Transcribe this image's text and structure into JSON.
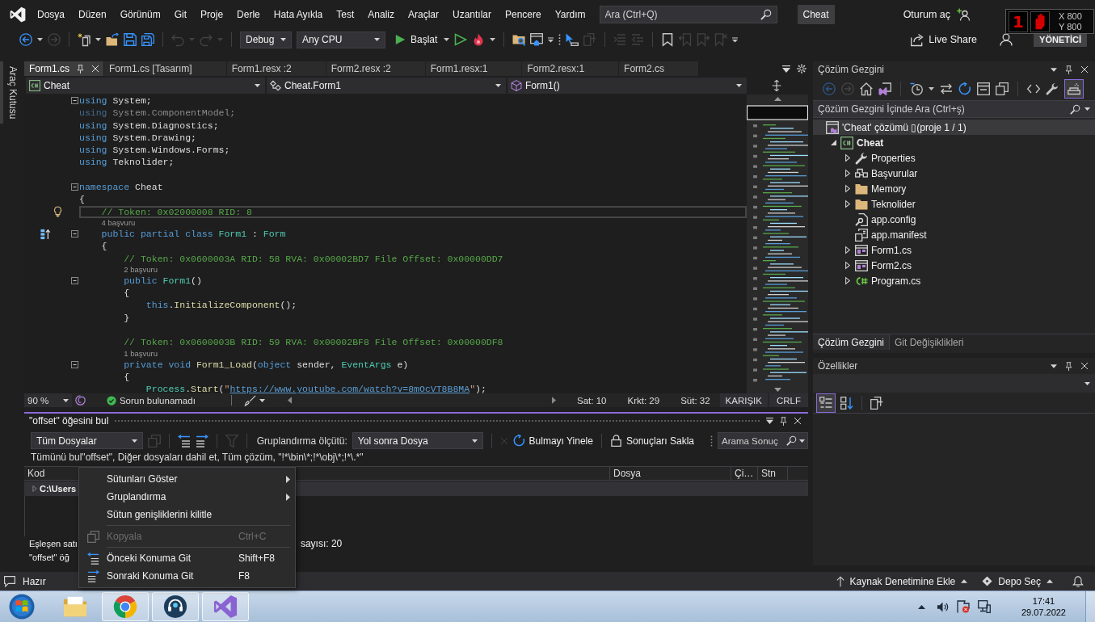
{
  "menu_bar": {
    "items": [
      "Dosya",
      "Düzen",
      "Görünüm",
      "Git",
      "Proje",
      "Derle",
      "Hata Ayıkla",
      "Test",
      "Analiz",
      "Araçlar",
      "Uzantılar",
      "Pencere",
      "Yardım"
    ],
    "search": {
      "placeholder": "Ara (Ctrl+Q)"
    },
    "solution_name": "Cheat",
    "sign_in": "Oturum aç"
  },
  "pointer_overlay": {
    "badge": "1",
    "readouts": [
      "X 800",
      "Y 800"
    ]
  },
  "toolbar": {
    "icons_before": [
      {
        "kind": "back",
        "disabled": false
      },
      {
        "kind": "caret",
        "disabled": false
      },
      {
        "kind": "forward",
        "disabled": true
      },
      {
        "kind": "separator"
      },
      {
        "kind": "new",
        "disabled": false
      },
      {
        "kind": "caret",
        "disabled": false
      },
      {
        "kind": "open",
        "disabled": false
      },
      {
        "kind": "save",
        "disabled": false
      },
      {
        "kind": "saveall",
        "disabled": false
      },
      {
        "kind": "separator"
      },
      {
        "kind": "undo",
        "disabled": true
      },
      {
        "kind": "caret",
        "disabled": true
      },
      {
        "kind": "redo",
        "disabled": true
      },
      {
        "kind": "caret",
        "disabled": true
      },
      {
        "kind": "separator"
      }
    ],
    "configuration": "Debug",
    "platform": "Any CPU",
    "start": "Başlat",
    "icons_after": [
      {
        "kind": "caret",
        "disabled": false
      },
      {
        "kind": "run",
        "disabled": false
      },
      {
        "kind": "hotreload",
        "disabled": false
      },
      {
        "kind": "caret",
        "disabled": false
      },
      {
        "kind": "separator"
      },
      {
        "kind": "findfiles",
        "disabled": false
      },
      {
        "kind": "window",
        "disabled": false
      },
      {
        "kind": "overflow",
        "disabled": false
      },
      {
        "kind": "grip",
        "disabled": false
      },
      {
        "kind": "cursor",
        "disabled": false
      },
      {
        "kind": "pages",
        "disabled": true
      },
      {
        "kind": "separator"
      },
      {
        "kind": "indent",
        "disabled": true
      },
      {
        "kind": "outdent",
        "disabled": true
      },
      {
        "kind": "separator"
      },
      {
        "kind": "bookmark",
        "disabled": false
      },
      {
        "kind": "bookmarkprev",
        "disabled": true
      },
      {
        "kind": "bookmarknext",
        "disabled": true
      },
      {
        "kind": "bookmarkclear",
        "disabled": true
      },
      {
        "kind": "overflow",
        "disabled": false
      }
    ],
    "live_share": "Live Share",
    "admin_badge": "YÖNETİCİ"
  },
  "toolbox_strip": {
    "label": "Araç Kutusu"
  },
  "editor": {
    "tabs": [
      {
        "label": "Form1.cs",
        "selected": true
      },
      {
        "label": "Form1.cs [Tasarım]",
        "selected": false
      },
      {
        "label": "Form1.resx :2",
        "selected": false
      },
      {
        "label": "Form2.resx :2",
        "selected": false
      },
      {
        "label": "Form1.resx:1",
        "selected": false
      },
      {
        "label": "Form2.resx:1",
        "selected": false
      },
      {
        "label": "Form2.cs",
        "selected": false
      }
    ],
    "navigation": [
      "Cheat",
      "Cheat.Form1",
      "Form1()"
    ],
    "lines": [
      {
        "kind": "code",
        "fold": true,
        "current": false,
        "spans": [
          {
            "kind": "keyword",
            "text": "using"
          },
          {
            "kind": "plain",
            "text": " System;"
          }
        ]
      },
      {
        "kind": "code",
        "fold": false,
        "current": false,
        "spans": [
          {
            "kind": "faded_keyword",
            "text": "using"
          },
          {
            "kind": "faded",
            "text": " System.ComponentModel;"
          }
        ]
      },
      {
        "kind": "code",
        "fold": false,
        "current": false,
        "spans": [
          {
            "kind": "keyword",
            "text": "using"
          },
          {
            "kind": "plain",
            "text": " System.Diagnostics;"
          }
        ]
      },
      {
        "kind": "code",
        "fold": false,
        "current": false,
        "spans": [
          {
            "kind": "keyword",
            "text": "using"
          },
          {
            "kind": "plain",
            "text": " System.Drawing;"
          }
        ]
      },
      {
        "kind": "code",
        "fold": false,
        "current": false,
        "spans": [
          {
            "kind": "keyword",
            "text": "using"
          },
          {
            "kind": "plain",
            "text": " System.Windows.Forms;"
          }
        ]
      },
      {
        "kind": "code",
        "fold": false,
        "current": false,
        "spans": [
          {
            "kind": "keyword",
            "text": "using"
          },
          {
            "kind": "plain",
            "text": " Teknolider;"
          }
        ]
      },
      {
        "kind": "blank"
      },
      {
        "kind": "code",
        "fold": true,
        "current": false,
        "spans": [
          {
            "kind": "keyword",
            "text": "namespace"
          },
          {
            "kind": "plain",
            "text": " Cheat"
          }
        ]
      },
      {
        "kind": "code",
        "fold": false,
        "current": false,
        "spans": [
          {
            "kind": "plain",
            "text": "{"
          }
        ]
      },
      {
        "kind": "code",
        "fold": false,
        "current": true,
        "glyph": {
          "kind": "lightbulb"
        },
        "spans": [
          {
            "kind": "comment",
            "text": "    // Token: 0x02000008 RID: 8"
          }
        ]
      },
      {
        "kind": "codelens",
        "text": "4 başvuru"
      },
      {
        "kind": "code",
        "fold": true,
        "current": false,
        "glyph": {
          "kind": "override"
        },
        "spans": [
          {
            "kind": "keyword",
            "text": "    public partial class "
          },
          {
            "kind": "type",
            "text": "Form1"
          },
          {
            "kind": "plain",
            "text": " : "
          },
          {
            "kind": "type",
            "text": "Form"
          }
        ]
      },
      {
        "kind": "code",
        "fold": false,
        "current": false,
        "spans": [
          {
            "kind": "plain",
            "text": "    {"
          }
        ]
      },
      {
        "kind": "code",
        "fold": false,
        "current": false,
        "spans": [
          {
            "kind": "comment",
            "text": "        // Token: 0x0600003A RID: 58 RVA: 0x00002BD7 File Offset: 0x00000DD7"
          }
        ]
      },
      {
        "kind": "codelens",
        "text": "2 başvuru"
      },
      {
        "kind": "code",
        "fold": true,
        "current": false,
        "spans": [
          {
            "kind": "keyword",
            "text": "        public "
          },
          {
            "kind": "type",
            "text": "Form1"
          },
          {
            "kind": "plain",
            "text": "()"
          }
        ]
      },
      {
        "kind": "code",
        "fold": false,
        "current": false,
        "spans": [
          {
            "kind": "plain",
            "text": "        {"
          }
        ]
      },
      {
        "kind": "code",
        "fold": false,
        "current": false,
        "spans": [
          {
            "kind": "keyword",
            "text": "            this"
          },
          {
            "kind": "plain",
            "text": "."
          },
          {
            "kind": "method",
            "text": "InitializeComponent"
          },
          {
            "kind": "plain",
            "text": "();"
          }
        ]
      },
      {
        "kind": "code",
        "fold": false,
        "current": false,
        "spans": [
          {
            "kind": "plain",
            "text": "        }"
          }
        ]
      },
      {
        "kind": "blank"
      },
      {
        "kind": "code",
        "fold": false,
        "current": false,
        "spans": [
          {
            "kind": "comment",
            "text": "        // Token: 0x0600003B RID: 59 RVA: 0x00002BF8 File Offset: 0x00000DF8"
          }
        ]
      },
      {
        "kind": "codelens",
        "text": "1 başvuru"
      },
      {
        "kind": "code",
        "fold": true,
        "current": false,
        "spans": [
          {
            "kind": "keyword",
            "text": "        private void "
          },
          {
            "kind": "method",
            "text": "Form1_Load"
          },
          {
            "kind": "plain",
            "text": "("
          },
          {
            "kind": "keyword",
            "text": "object"
          },
          {
            "kind": "plain",
            "text": " sender, "
          },
          {
            "kind": "type",
            "text": "EventArgs"
          },
          {
            "kind": "plain",
            "text": " e)"
          }
        ]
      },
      {
        "kind": "code",
        "fold": false,
        "current": false,
        "spans": [
          {
            "kind": "plain",
            "text": "        {"
          }
        ]
      },
      {
        "kind": "code",
        "fold": false,
        "current": false,
        "spans": [
          {
            "kind": "type",
            "text": "            Process"
          },
          {
            "kind": "plain",
            "text": "."
          },
          {
            "kind": "method",
            "text": "Start"
          },
          {
            "kind": "plain",
            "text": "("
          },
          {
            "kind": "string",
            "text": "\""
          },
          {
            "kind": "link",
            "text": "https://www.youtube.com/watch?v=8mOcVT8B8MA"
          },
          {
            "kind": "string",
            "text": "\""
          },
          {
            "kind": "plain",
            "text": ");"
          }
        ]
      }
    ],
    "status": {
      "zoom": "90 %",
      "issues": "Sorun bulunamadı",
      "line": "Sat: 10",
      "character": "Krkt: 29",
      "column": "Süt: 32",
      "indentation": "KARIŞIK",
      "line_ending": "CRLF"
    }
  },
  "find_results": {
    "title": "\"offset\" öğesini bul",
    "scope": "Tüm Dosyalar",
    "tools": [
      {
        "kind": "copy",
        "disabled": true
      },
      {
        "kind": "separator"
      },
      {
        "kind": "previous",
        "disabled": false
      },
      {
        "kind": "next",
        "disabled": false
      },
      {
        "kind": "separator"
      },
      {
        "kind": "filter",
        "disabled": true
      },
      {
        "kind": "separator"
      }
    ],
    "group_label": "Gruplandırma ölçütü:",
    "group_by": "Yol sonra Dosya",
    "clear": {
      "disabled": true
    },
    "actions": [
      {
        "kind": "refresh",
        "label": "Bulmayı Yinele"
      },
      {
        "kind": "lock",
        "label": "Sonuçları Sakla"
      }
    ],
    "search": {
      "placeholder": "Arama Sonuç"
    },
    "query": "Tümünü bul\"offset\", Diğer dosyaları dahil et, Tüm çözüm, \"!*\\bin\\*;!*\\obj\\*;!*\\.*\"",
    "columns": [
      "Kod",
      "Dosya",
      "Çi…",
      "Stn"
    ],
    "rows": [
      {
        "text": "C:\\Users",
        "expanded": false
      }
    ],
    "summary": [
      {
        "parts": [
          "Eşleşen satı",
          "sayısı: 20"
        ]
      },
      {
        "parts": [
          "\"offset\" öğ"
        ]
      }
    ]
  },
  "context_menu": {
    "items": [
      {
        "kind": "plain",
        "label": "Sütunları Göster",
        "submenu": true,
        "disabled": false
      },
      {
        "kind": "plain",
        "label": "Gruplandırma",
        "submenu": true,
        "disabled": false
      },
      {
        "kind": "plain",
        "label": "Sütun genişliklerini kilitle",
        "submenu": false,
        "disabled": false
      },
      {
        "kind": "separator"
      },
      {
        "kind": "copy",
        "label": "Kopyala",
        "shortcut": "Ctrl+C",
        "submenu": false,
        "disabled": true
      },
      {
        "kind": "separator"
      },
      {
        "kind": "previous",
        "label": "Önceki Konuma Git",
        "shortcut": "Shift+F8",
        "submenu": false,
        "disabled": false
      },
      {
        "kind": "next",
        "label": "Sonraki Konuma Git",
        "shortcut": "F8",
        "submenu": false,
        "disabled": false
      }
    ]
  },
  "solution_explorer": {
    "title": "Çözüm Gezgini",
    "toolbar": [
      {
        "kind": "back",
        "disabled": true,
        "on": false
      },
      {
        "kind": "forward",
        "disabled": true,
        "on": false
      },
      {
        "kind": "home",
        "disabled": false,
        "on": false
      },
      {
        "kind": "switchview",
        "disabled": false,
        "on": false
      },
      {
        "kind": "separator"
      },
      {
        "kind": "history",
        "disabled": false,
        "on": false
      },
      {
        "kind": "caret",
        "disabled": false,
        "on": false
      },
      {
        "kind": "sync",
        "disabled": false,
        "on": false
      },
      {
        "kind": "refresh",
        "disabled": false,
        "on": false
      },
      {
        "kind": "collapseall",
        "disabled": false,
        "on": false
      },
      {
        "kind": "showall",
        "disabled": false,
        "on": false
      },
      {
        "kind": "separator"
      },
      {
        "kind": "code",
        "disabled": false,
        "on": false
      },
      {
        "kind": "wrench",
        "disabled": false,
        "on": false
      },
      {
        "kind": "preview",
        "disabled": false,
        "on": true
      }
    ],
    "search": {
      "placeholder": "Çözüm Gezgini İçinde Ara (Ctrl+ş)"
    },
    "tree": [
      {
        "kind": "solution",
        "label": "'Cheat' çözümü ▯(proje 1 / 1)",
        "selected": true,
        "children": [
          {
            "kind": "project",
            "label": "Cheat",
            "selected": false,
            "expanded": true,
            "children": [
              {
                "kind": "properties",
                "label": "Properties",
                "selected": false,
                "expanded": false
              },
              {
                "kind": "references",
                "label": "Başvurular",
                "selected": false,
                "expanded": false
              },
              {
                "kind": "folder",
                "label": "Memory",
                "selected": false,
                "expanded": false
              },
              {
                "kind": "folder",
                "label": "Teknolider",
                "selected": false,
                "expanded": false
              },
              {
                "kind": "config",
                "label": "app.config",
                "selected": false
              },
              {
                "kind": "manifest",
                "label": "app.manifest",
                "selected": false
              },
              {
                "kind": "form",
                "label": "Form1.cs",
                "selected": false,
                "expanded": false
              },
              {
                "kind": "form",
                "label": "Form2.cs",
                "selected": false,
                "expanded": false
              },
              {
                "kind": "csharp",
                "label": "Program.cs",
                "selected": false,
                "expanded": false
              }
            ]
          }
        ]
      }
    ],
    "tabs": [
      {
        "label": "Çözüm Gezgini",
        "selected": true
      },
      {
        "label": "Git Değişiklikleri",
        "selected": false
      }
    ]
  },
  "properties": {
    "title": "Özellikler",
    "toolbar": [
      {
        "kind": "categorized",
        "selected": true
      },
      {
        "kind": "alphabetical",
        "selected": false
      },
      {
        "kind": "separator"
      },
      {
        "kind": "pages",
        "selected": false
      }
    ]
  },
  "status_bar": {
    "message": "Hazır",
    "source_control": "Kaynak Denetimine Ekle",
    "repository": "Depo Seç"
  },
  "taskbar": {
    "apps": [
      {
        "kind": "explorer",
        "running": false
      },
      {
        "kind": "browser",
        "running": true
      },
      {
        "kind": "headset",
        "running": true
      },
      {
        "kind": "studio",
        "running": true
      }
    ],
    "time": "17:41",
    "date": "29.07.2022"
  }
}
